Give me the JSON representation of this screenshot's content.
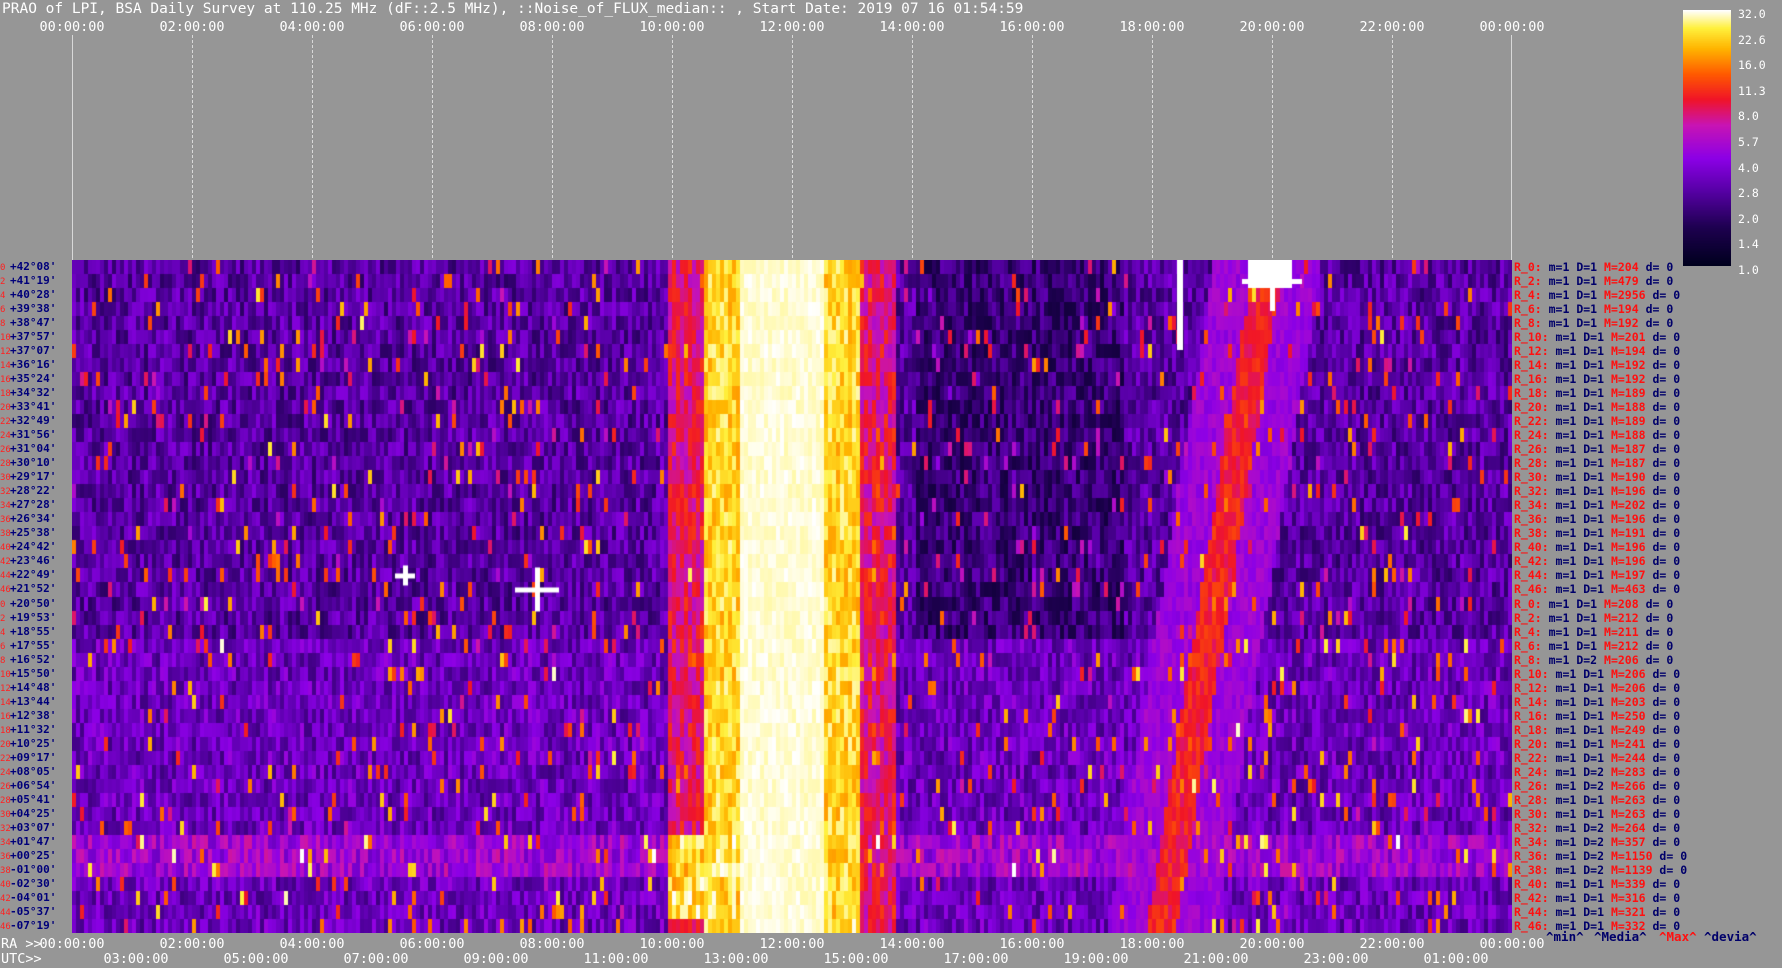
{
  "title": "PRAO of LPI, BSA Daily Survey at 110.25 MHz (dF::2.5 MHz), ::Noise_of_FLUX_median:: , Start Date: 2019 07 16 01:54:59",
  "axes": {
    "ra_prefix": "RA >>",
    "utc_prefix": "UTC>>"
  },
  "legend_footer": {
    "min": "^min^",
    "media": "^Media^",
    "max": "^Max^",
    "devia": "^devia^"
  },
  "colors": {
    "background": "#969696",
    "max": "#ff1010",
    "text_dark": "#00006a"
  },
  "chart_data": {
    "type": "heatmap",
    "top_ticks": [
      "00:00:00",
      "02:00:00",
      "04:00:00",
      "06:00:00",
      "08:00:00",
      "10:00:00",
      "12:00:00",
      "14:00:00",
      "16:00:00",
      "18:00:00",
      "20:00:00",
      "22:00:00",
      "00:00:00"
    ],
    "ra_ticks": [
      "00:00:00",
      "02:00:00",
      "04:00:00",
      "06:00:00",
      "08:00:00",
      "10:00:00",
      "12:00:00",
      "14:00:00",
      "16:00:00",
      "18:00:00",
      "20:00:00",
      "22:00:00",
      "00:00:00"
    ],
    "utc_ticks": [
      "03:00:00",
      "05:00:00",
      "07:00:00",
      "09:00:00",
      "11:00:00",
      "13:00:00",
      "15:00:00",
      "17:00:00",
      "19:00:00",
      "21:00:00",
      "23:00:00",
      "01:00:00"
    ],
    "colorbar": [
      "32.0",
      "22.6",
      "16.0",
      "11.3",
      "8.0",
      "5.7",
      "4.0",
      "2.8",
      "2.0",
      "1.4",
      "1.0"
    ],
    "rows": [
      {
        "i": "0",
        "dec": "+42°08'"
      },
      {
        "i": "2",
        "dec": "+41°19'"
      },
      {
        "i": "4",
        "dec": "+40°28'"
      },
      {
        "i": "6",
        "dec": "+39°38'"
      },
      {
        "i": "8",
        "dec": "+38°47'"
      },
      {
        "i": "10",
        "dec": "+37°57'"
      },
      {
        "i": "12",
        "dec": "+37°07'"
      },
      {
        "i": "14",
        "dec": "+36°16'"
      },
      {
        "i": "16",
        "dec": "+35°24'"
      },
      {
        "i": "18",
        "dec": "+34°32'"
      },
      {
        "i": "20",
        "dec": "+33°41'"
      },
      {
        "i": "22",
        "dec": "+32°49'"
      },
      {
        "i": "24",
        "dec": "+31°56'"
      },
      {
        "i": "26",
        "dec": "+31°04'"
      },
      {
        "i": "28",
        "dec": "+30°10'"
      },
      {
        "i": "30",
        "dec": "+29°17'"
      },
      {
        "i": "32",
        "dec": "+28°22'"
      },
      {
        "i": "34",
        "dec": "+27°28'"
      },
      {
        "i": "36",
        "dec": "+26°34'"
      },
      {
        "i": "38",
        "dec": "+25°38'"
      },
      {
        "i": "40",
        "dec": "+24°42'"
      },
      {
        "i": "42",
        "dec": "+23°46'"
      },
      {
        "i": "44",
        "dec": "+22°49'"
      },
      {
        "i": "46",
        "dec": "+21°52'"
      },
      {
        "i": "0",
        "dec": "+20°50'"
      },
      {
        "i": "2",
        "dec": "+19°53'"
      },
      {
        "i": "4",
        "dec": "+18°55'"
      },
      {
        "i": "6",
        "dec": "+17°55'"
      },
      {
        "i": "8",
        "dec": "+16°52'"
      },
      {
        "i": "10",
        "dec": "+15°50'"
      },
      {
        "i": "12",
        "dec": "+14°48'"
      },
      {
        "i": "14",
        "dec": "+13°44'"
      },
      {
        "i": "16",
        "dec": "+12°38'"
      },
      {
        "i": "18",
        "dec": "+11°32'"
      },
      {
        "i": "20",
        "dec": "+10°25'"
      },
      {
        "i": "22",
        "dec": "+09°17'"
      },
      {
        "i": "24",
        "dec": "+08°05'"
      },
      {
        "i": "26",
        "dec": "+06°54'"
      },
      {
        "i": "28",
        "dec": "+05°41'"
      },
      {
        "i": "30",
        "dec": "+04°25'"
      },
      {
        "i": "32",
        "dec": "+03°07'"
      },
      {
        "i": "34",
        "dec": "+01°47'"
      },
      {
        "i": "36",
        "dec": "+00°25'"
      },
      {
        "i": "38",
        "dec": "-01°00'"
      },
      {
        "i": "40",
        "dec": "-02°30'"
      },
      {
        "i": "42",
        "dec": "-04°01'"
      },
      {
        "i": "44",
        "dec": "-05°37'"
      },
      {
        "i": "46",
        "dec": "-07°19'"
      }
    ],
    "stats": [
      {
        "r": "R_0:",
        "m": "m=1",
        "d": "D=1",
        "mx": "M=204",
        "dv": "d= 0"
      },
      {
        "r": "R_2:",
        "m": "m=1",
        "d": "D=1",
        "mx": "M=479",
        "dv": "d= 0"
      },
      {
        "r": "R_4:",
        "m": "m=1",
        "d": "D=1",
        "mx": "M=2956",
        "dv": "d= 0"
      },
      {
        "r": "R_6:",
        "m": "m=1",
        "d": "D=1",
        "mx": "M=194",
        "dv": "d= 0"
      },
      {
        "r": "R_8:",
        "m": "m=1",
        "d": "D=1",
        "mx": "M=192",
        "dv": "d= 0"
      },
      {
        "r": "R_10:",
        "m": "m=1",
        "d": "D=1",
        "mx": "M=201",
        "dv": "d= 0"
      },
      {
        "r": "R_12:",
        "m": "m=1",
        "d": "D=1",
        "mx": "M=194",
        "dv": "d= 0"
      },
      {
        "r": "R_14:",
        "m": "m=1",
        "d": "D=1",
        "mx": "M=192",
        "dv": "d= 0"
      },
      {
        "r": "R_16:",
        "m": "m=1",
        "d": "D=1",
        "mx": "M=192",
        "dv": "d= 0"
      },
      {
        "r": "R_18:",
        "m": "m=1",
        "d": "D=1",
        "mx": "M=189",
        "dv": "d= 0"
      },
      {
        "r": "R_20:",
        "m": "m=1",
        "d": "D=1",
        "mx": "M=188",
        "dv": "d= 0"
      },
      {
        "r": "R_22:",
        "m": "m=1",
        "d": "D=1",
        "mx": "M=189",
        "dv": "d= 0"
      },
      {
        "r": "R_24:",
        "m": "m=1",
        "d": "D=1",
        "mx": "M=188",
        "dv": "d= 0"
      },
      {
        "r": "R_26:",
        "m": "m=1",
        "d": "D=1",
        "mx": "M=187",
        "dv": "d= 0"
      },
      {
        "r": "R_28:",
        "m": "m=1",
        "d": "D=1",
        "mx": "M=187",
        "dv": "d= 0"
      },
      {
        "r": "R_30:",
        "m": "m=1",
        "d": "D=1",
        "mx": "M=190",
        "dv": "d= 0"
      },
      {
        "r": "R_32:",
        "m": "m=1",
        "d": "D=1",
        "mx": "M=196",
        "dv": "d= 0"
      },
      {
        "r": "R_34:",
        "m": "m=1",
        "d": "D=1",
        "mx": "M=202",
        "dv": "d= 0"
      },
      {
        "r": "R_36:",
        "m": "m=1",
        "d": "D=1",
        "mx": "M=196",
        "dv": "d= 0"
      },
      {
        "r": "R_38:",
        "m": "m=1",
        "d": "D=1",
        "mx": "M=191",
        "dv": "d= 0"
      },
      {
        "r": "R_40:",
        "m": "m=1",
        "d": "D=1",
        "mx": "M=196",
        "dv": "d= 0"
      },
      {
        "r": "R_42:",
        "m": "m=1",
        "d": "D=1",
        "mx": "M=196",
        "dv": "d= 0"
      },
      {
        "r": "R_44:",
        "m": "m=1",
        "d": "D=1",
        "mx": "M=197",
        "dv": "d= 0"
      },
      {
        "r": "R_46:",
        "m": "m=1",
        "d": "D=1",
        "mx": "M=463",
        "dv": "d= 0"
      },
      {
        "r": "R_0:",
        "m": "m=1",
        "d": "D=1",
        "mx": "M=208",
        "dv": "d= 0"
      },
      {
        "r": "R_2:",
        "m": "m=1",
        "d": "D=1",
        "mx": "M=212",
        "dv": "d= 0"
      },
      {
        "r": "R_4:",
        "m": "m=1",
        "d": "D=1",
        "mx": "M=211",
        "dv": "d= 0"
      },
      {
        "r": "R_6:",
        "m": "m=1",
        "d": "D=1",
        "mx": "M=212",
        "dv": "d= 0"
      },
      {
        "r": "R_8:",
        "m": "m=1",
        "d": "D=2",
        "mx": "M=206",
        "dv": "d= 0"
      },
      {
        "r": "R_10:",
        "m": "m=1",
        "d": "D=1",
        "mx": "M=206",
        "dv": "d= 0"
      },
      {
        "r": "R_12:",
        "m": "m=1",
        "d": "D=1",
        "mx": "M=206",
        "dv": "d= 0"
      },
      {
        "r": "R_14:",
        "m": "m=1",
        "d": "D=1",
        "mx": "M=203",
        "dv": "d= 0"
      },
      {
        "r": "R_16:",
        "m": "m=1",
        "d": "D=1",
        "mx": "M=250",
        "dv": "d= 0"
      },
      {
        "r": "R_18:",
        "m": "m=1",
        "d": "D=1",
        "mx": "M=249",
        "dv": "d= 0"
      },
      {
        "r": "R_20:",
        "m": "m=1",
        "d": "D=1",
        "mx": "M=241",
        "dv": "d= 0"
      },
      {
        "r": "R_22:",
        "m": "m=1",
        "d": "D=1",
        "mx": "M=244",
        "dv": "d= 0"
      },
      {
        "r": "R_24:",
        "m": "m=1",
        "d": "D=2",
        "mx": "M=283",
        "dv": "d= 0"
      },
      {
        "r": "R_26:",
        "m": "m=1",
        "d": "D=2",
        "mx": "M=266",
        "dv": "d= 0"
      },
      {
        "r": "R_28:",
        "m": "m=1",
        "d": "D=1",
        "mx": "M=263",
        "dv": "d= 0"
      },
      {
        "r": "R_30:",
        "m": "m=1",
        "d": "D=1",
        "mx": "M=263",
        "dv": "d= 0"
      },
      {
        "r": "R_32:",
        "m": "m=1",
        "d": "D=2",
        "mx": "M=264",
        "dv": "d= 0"
      },
      {
        "r": "R_34:",
        "m": "m=1",
        "d": "D=2",
        "mx": "M=357",
        "dv": "d= 0"
      },
      {
        "r": "R_36:",
        "m": "m=1",
        "d": "D=2",
        "mx": "M=1150",
        "dv": "d= 0"
      },
      {
        "r": "R_38:",
        "m": "m=1",
        "d": "D=2",
        "mx": "M=1139",
        "dv": "d= 0"
      },
      {
        "r": "R_40:",
        "m": "m=1",
        "d": "D=1",
        "mx": "M=339",
        "dv": "d= 0"
      },
      {
        "r": "R_42:",
        "m": "m=1",
        "d": "D=1",
        "mx": "M=316",
        "dv": "d= 0"
      },
      {
        "r": "R_44:",
        "m": "m=1",
        "d": "D=1",
        "mx": "M=321",
        "dv": "d= 0"
      },
      {
        "r": "R_46:",
        "m": "m=1",
        "d": "D=1",
        "mx": "M=332",
        "dv": "d= 0"
      }
    ]
  }
}
